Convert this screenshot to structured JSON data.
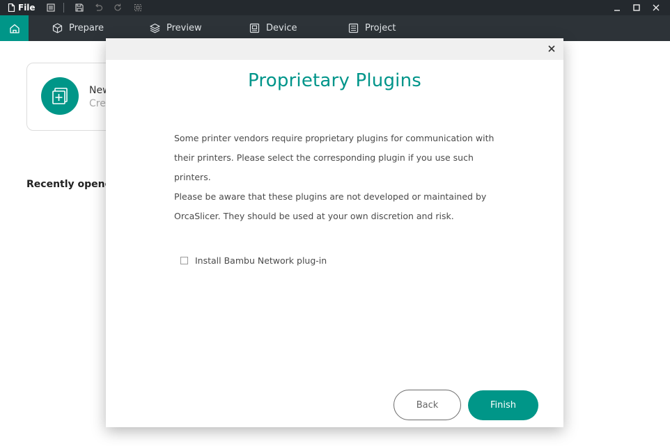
{
  "titlebar": {
    "file_label": "File",
    "icons": [
      "file-icon",
      "list-icon",
      "save-icon",
      "undo-icon",
      "redo-icon",
      "crop-icon"
    ],
    "window_controls": [
      "minimize-icon",
      "maximize-icon",
      "close-icon"
    ]
  },
  "tabs": [
    {
      "label": "Prepare",
      "icon": "cube-icon"
    },
    {
      "label": "Preview",
      "icon": "layers-icon"
    },
    {
      "label": "Device",
      "icon": "device-icon"
    },
    {
      "label": "Project",
      "icon": "project-icon"
    }
  ],
  "home": {
    "new_project_title": "New",
    "new_project_subtitle": "Crea",
    "recently_opened": "Recently opened"
  },
  "modal": {
    "title": "Proprietary Plugins",
    "paragraphs": [
      "Some printer vendors require proprietary plugins for communication with their printers. Please select the corresponding plugin if you use such printers.",
      "Please be aware that these plugins are not developed or maintained by OrcaSlicer. They should be used at your own discretion and risk."
    ],
    "checkbox_label": "Install Bambu Network plug-in",
    "checkbox_checked": false,
    "back_label": "Back",
    "finish_label": "Finish"
  },
  "colors": {
    "accent": "#009688",
    "titlebar": "#24292e",
    "tabbar": "#2d3338"
  }
}
